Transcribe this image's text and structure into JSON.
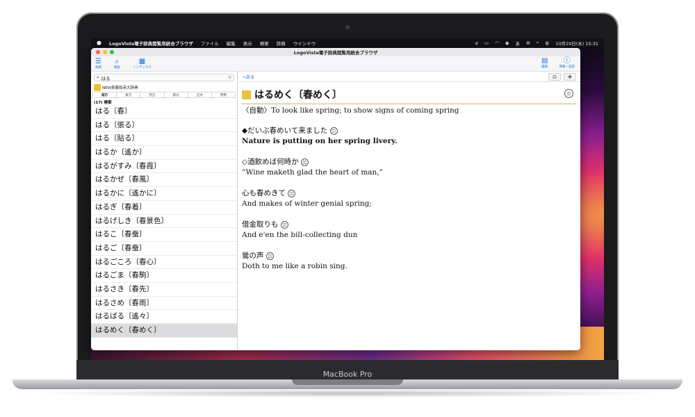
{
  "device": {
    "label": "MacBook Pro"
  },
  "menubar": {
    "apple": "",
    "app_name": "LogoVista電子辞典閲覧用統合ブラウザ",
    "menus": [
      "ファイル",
      "編集",
      "表示",
      "検索",
      "辞典",
      "ウインドウ"
    ],
    "clock": "10月19日(水)  15:31"
  },
  "window": {
    "title": "LogoVista電子辞典閲覧用統合ブラウザ",
    "toolbar": {
      "left": [
        {
          "icon": "list-icon",
          "label": "辞典"
        },
        {
          "icon": "search-icon",
          "label": "検索"
        },
        {
          "icon": "grid-icon",
          "label": "インデックス"
        }
      ],
      "right": [
        {
          "icon": "history-icon",
          "label": "履歴"
        },
        {
          "icon": "info-icon",
          "label": "情報・設定"
        }
      ]
    }
  },
  "search": {
    "value": "はる"
  },
  "dictionary": {
    "name": "NEW斎藤和英大辞典",
    "icon_text": "NEW 斎藤和英 大辞典"
  },
  "modes": [
    "前方",
    "後方",
    "完全",
    "部分",
    "全文",
    "用例"
  ],
  "results": {
    "count": "(17) 検索",
    "items": [
      "はる〔春〕",
      "はる〔張る〕",
      "はる〔貼る〕",
      "はるか〔遙か〕",
      "はるがすみ〔春霞〕",
      "はるかぜ〔春風〕",
      "はるかに〔遙かに〕",
      "はるぎ〔春着〕",
      "はるげしき〔春景色〕",
      "はるこ〔春蚕〕",
      "はるご〔春蚕〕",
      "はるごころ〔春心〕",
      "はるごま〔春駒〕",
      "はるさき〔春先〕",
      "はるさめ〔春雨〕",
      "はるばる〔遙々〕",
      "はるめく〔春めく〕"
    ],
    "selected_index": 16
  },
  "detail": {
    "back_label": "<戻る",
    "headword": "はるめく〔春めく〕",
    "gloss": "〈自動〉To look like spring; to show signs of coming spring",
    "examples": [
      {
        "jp": "◆だいぶ春めいて来ました",
        "en": "Nature is putting on her spring livery.",
        "bold": true
      },
      {
        "jp": "◇酒飲めば何時か",
        "en": "“Wine maketh glad the heart of man,”",
        "bold": false
      },
      {
        "jp": "心も春めきて",
        "en": "And makes of winter genial spring;",
        "bold": false
      },
      {
        "jp": "借金取りも",
        "en": "And e'en the bill-collecting dun",
        "bold": false
      },
      {
        "jp": "鶯の声",
        "en": "Doth to me like a robin sing.",
        "bold": false
      }
    ]
  }
}
